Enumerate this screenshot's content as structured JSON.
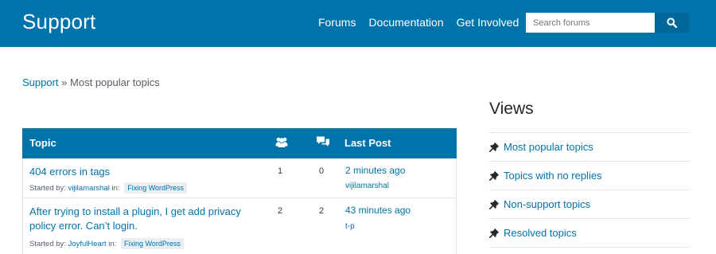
{
  "header": {
    "brand": "Support",
    "nav": [
      "Forums",
      "Documentation",
      "Get Involved"
    ],
    "search": {
      "placeholder": "Search forums"
    }
  },
  "breadcrumb": {
    "home": "Support",
    "separator": "»",
    "current": "Most popular topics"
  },
  "table": {
    "headers": {
      "topic": "Topic",
      "last_post": "Last Post"
    },
    "header_icons": {
      "voices": "people-icon",
      "posts": "speech-bubbles-icon"
    },
    "rows": [
      {
        "title": "404 errors in tags",
        "started_by_label": "Started by:",
        "author": "vijilamarshal",
        "in_label": "in:",
        "forum": "Fixing WordPress",
        "voices": "1",
        "posts": "0",
        "freshness": "2 minutes ago",
        "last_author": "vijilamarshal"
      },
      {
        "title": "After trying to install a plugin, I get add privacy policy error. Can’t login.",
        "started_by_label": "Started by:",
        "author": "JoyfulHeart",
        "in_label": "in:",
        "forum": "Fixing WordPress",
        "voices": "2",
        "posts": "2",
        "freshness": "43 minutes ago",
        "last_author": "t-p"
      }
    ]
  },
  "sidebar": {
    "title": "Views",
    "items": [
      {
        "label": "Most popular topics",
        "icon": "pin-icon"
      },
      {
        "label": "Topics with no replies",
        "icon": "pin-icon"
      },
      {
        "label": "Non-support topics",
        "icon": "pin-icon"
      },
      {
        "label": "Resolved topics",
        "icon": "pin-icon"
      }
    ]
  },
  "colors": {
    "brand_blue": "#0073aa",
    "search_button": "#006799",
    "link": "#0073aa",
    "border": "#e2e4e7"
  }
}
